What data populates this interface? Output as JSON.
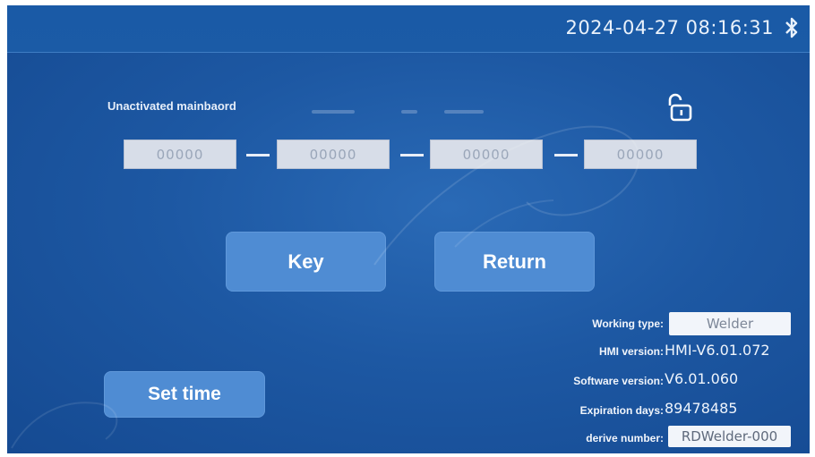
{
  "header": {
    "datetime": "2024-04-27 08:16:31",
    "bluetooth_icon": "bluetooth-icon"
  },
  "activation": {
    "status_text": "Unactivated mainbaord",
    "lock_icon": "unlocked-padlock-icon",
    "code_fields": [
      "00000",
      "00000",
      "00000",
      "00000"
    ]
  },
  "buttons": {
    "key": "Key",
    "return": "Return",
    "set_time": "Set time"
  },
  "info": {
    "working_type_label": "Working type:",
    "working_type_value": "Welder",
    "hmi_version_label": "HMI version:",
    "hmi_version_value": "HMI-V6.01.072",
    "software_version_label": "Software version:",
    "software_version_value": "V6.01.060",
    "expiration_days_label": "Expiration days:",
    "expiration_days_value": "89478485",
    "derive_number_label": "derive number:",
    "derive_number_value": "RDWelder-000"
  },
  "colors": {
    "background": "#1d58a3",
    "button": "#4f8cd3",
    "field": "#d7dde8"
  }
}
